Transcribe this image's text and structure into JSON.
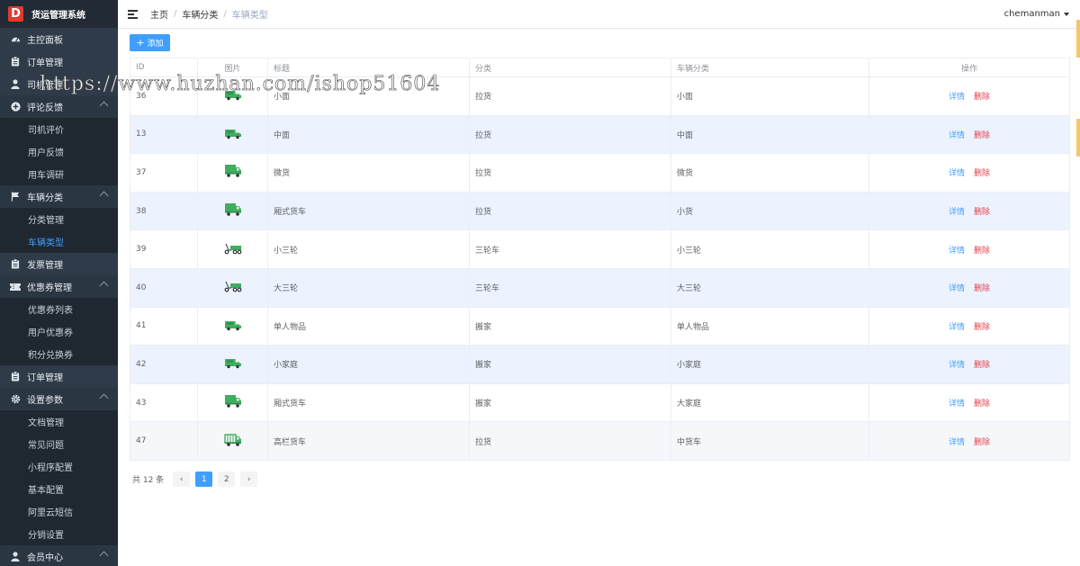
{
  "app": {
    "logo_letter": "D",
    "title": "货运管理系统"
  },
  "sidebar": {
    "items": [
      {
        "label": "主控面板",
        "icon": "dashboard-icon",
        "type": "top"
      },
      {
        "label": "订单管理",
        "icon": "clipboard-icon",
        "type": "top"
      },
      {
        "label": "司机管理",
        "icon": "user-icon",
        "type": "top"
      },
      {
        "label": "评论反馈",
        "icon": "plus-circle-icon",
        "type": "group"
      },
      {
        "label": "司机评价",
        "type": "sub"
      },
      {
        "label": "用户反馈",
        "type": "sub"
      },
      {
        "label": "用车调研",
        "type": "sub"
      },
      {
        "label": "车辆分类",
        "icon": "flag-icon",
        "type": "group"
      },
      {
        "label": "分类管理",
        "type": "sub"
      },
      {
        "label": "车辆类型",
        "type": "sub",
        "active": true
      },
      {
        "label": "发票管理",
        "icon": "clipboard-icon",
        "type": "top"
      },
      {
        "label": "优惠券管理",
        "icon": "ticket-icon",
        "type": "group"
      },
      {
        "label": "优惠券列表",
        "type": "sub"
      },
      {
        "label": "用户优惠券",
        "type": "sub"
      },
      {
        "label": "积分兑换券",
        "type": "sub"
      },
      {
        "label": "订单管理",
        "icon": "clipboard-icon",
        "type": "top"
      },
      {
        "label": "设置参数",
        "icon": "gear-icon",
        "type": "group"
      },
      {
        "label": "文档管理",
        "type": "sub"
      },
      {
        "label": "常见问题",
        "type": "sub"
      },
      {
        "label": "小程序配置",
        "type": "sub"
      },
      {
        "label": "基本配置",
        "type": "sub"
      },
      {
        "label": "阿里云短信",
        "type": "sub"
      },
      {
        "label": "分销设置",
        "type": "sub"
      },
      {
        "label": "会员中心",
        "icon": "user-icon",
        "type": "group"
      }
    ]
  },
  "breadcrumb": {
    "home": "主页",
    "parent": "车辆分类",
    "current": "车辆类型"
  },
  "user": {
    "name": "chemanman"
  },
  "toolbar": {
    "add_label": "添加"
  },
  "table": {
    "headers": [
      "ID",
      "图片",
      "标题",
      "分类",
      "车辆分类",
      "操作"
    ],
    "detail_label": "详情",
    "delete_label": "删除",
    "rows": [
      {
        "id": "36",
        "title": "小面",
        "category": "拉货",
        "vehicle_class": "小面",
        "truck": "van"
      },
      {
        "id": "13",
        "title": "中面",
        "category": "拉货",
        "vehicle_class": "中面",
        "truck": "van"
      },
      {
        "id": "37",
        "title": "微货",
        "category": "拉货",
        "vehicle_class": "微货",
        "truck": "box"
      },
      {
        "id": "38",
        "title": "厢式货车",
        "category": "拉货",
        "vehicle_class": "小货",
        "truck": "box"
      },
      {
        "id": "39",
        "title": "小三轮",
        "category": "三轮车",
        "vehicle_class": "小三轮",
        "truck": "tricycle"
      },
      {
        "id": "40",
        "title": "大三轮",
        "category": "三轮车",
        "vehicle_class": "大三轮",
        "truck": "tricycle"
      },
      {
        "id": "41",
        "title": "单人物品",
        "category": "搬家",
        "vehicle_class": "单人物品",
        "truck": "van"
      },
      {
        "id": "42",
        "title": "小家庭",
        "category": "搬家",
        "vehicle_class": "小家庭",
        "truck": "van"
      },
      {
        "id": "43",
        "title": "厢式货车",
        "category": "搬家",
        "vehicle_class": "大家庭",
        "truck": "box"
      },
      {
        "id": "47",
        "title": "高栏货车",
        "category": "拉货",
        "vehicle_class": "中货车",
        "truck": "flatbed"
      }
    ]
  },
  "pagination": {
    "total_label": "共 12 条",
    "pages": [
      "1",
      "2"
    ],
    "current": "1",
    "prev": "‹",
    "next": "›"
  },
  "watermark": "https://www.huzhan.com/ishop51604",
  "colors": {
    "sidebar_bg": "#2b3643",
    "accent": "#409eff",
    "danger": "#e0424b",
    "truck": "#3fae5f"
  }
}
